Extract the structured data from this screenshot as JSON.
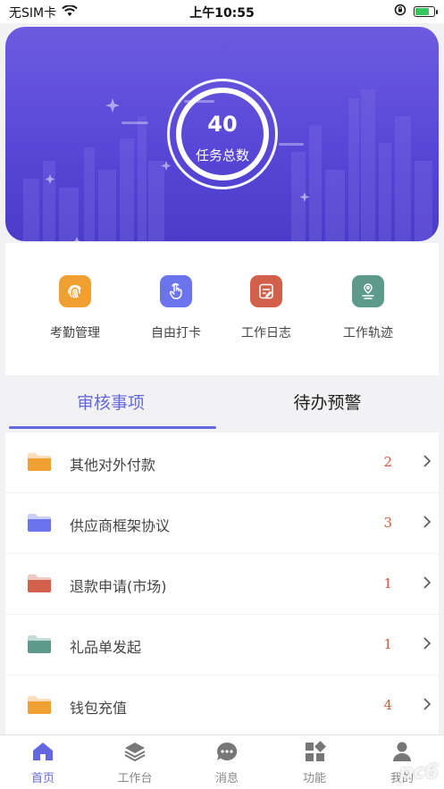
{
  "status_bar": {
    "carrier": "无SIM卡",
    "time": "上午10:55",
    "battery_level": 0.8
  },
  "hero": {
    "task_total_value": "40",
    "task_total_label": "任务总数"
  },
  "shortcuts": [
    {
      "label": "考勤管理",
      "icon": "fingerprint-icon",
      "color": "#f0a030"
    },
    {
      "label": "自由打卡",
      "icon": "tap-hand-icon",
      "color": "#6b74ec"
    },
    {
      "label": "工作日志",
      "icon": "journal-icon",
      "color": "#d2604a"
    },
    {
      "label": "工作轨迹",
      "icon": "location-track-icon",
      "color": "#5d9a8c"
    }
  ],
  "tabs": {
    "review": "审核事项",
    "pending": "待办预警"
  },
  "review_items": [
    {
      "name": "其他对外付款",
      "count": "2",
      "folder_color": "#f0a030"
    },
    {
      "name": "供应商框架协议",
      "count": "3",
      "folder_color": "#6b74ec"
    },
    {
      "name": "退款申请(市场)",
      "count": "1",
      "folder_color": "#d2604a"
    },
    {
      "name": "礼品单发起",
      "count": "1",
      "folder_color": "#5d9a8c"
    },
    {
      "name": "钱包充值",
      "count": "4",
      "folder_color": "#f0a030"
    }
  ],
  "bottom_nav": [
    {
      "label": "首页",
      "icon": "home-icon",
      "active": true
    },
    {
      "label": "工作台",
      "icon": "layers-icon",
      "active": false
    },
    {
      "label": "消息",
      "icon": "chat-icon",
      "active": false
    },
    {
      "label": "功能",
      "icon": "grid-icon",
      "active": false
    },
    {
      "label": "我的",
      "icon": "user-icon",
      "active": false
    }
  ],
  "watermark": "pc6",
  "colors": {
    "accent": "#6468e0",
    "hero_top": "#6c5be0",
    "hero_bottom": "#4a3cc8",
    "count_red": "#d05a3c"
  }
}
